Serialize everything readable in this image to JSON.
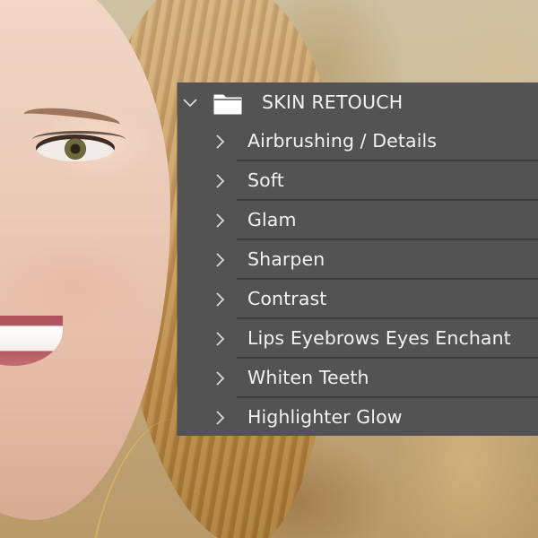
{
  "layers_panel": {
    "group": {
      "label": "SKIN RETOUCH",
      "icon": "folder-icon",
      "expanded_icon": "chevron-down-icon"
    },
    "items": [
      {
        "label": "Airbrushing / Details",
        "icon": "chevron-right-icon"
      },
      {
        "label": "Soft",
        "icon": "chevron-right-icon"
      },
      {
        "label": "Glam",
        "icon": "chevron-right-icon"
      },
      {
        "label": "Sharpen",
        "icon": "chevron-right-icon"
      },
      {
        "label": "Contrast",
        "icon": "chevron-right-icon"
      },
      {
        "label": "Lips Eyebrows Eyes Enchant",
        "icon": "chevron-right-icon"
      },
      {
        "label": "Whiten Teeth",
        "icon": "chevron-right-icon"
      },
      {
        "label": "Highlighter Glow",
        "icon": "chevron-right-icon"
      }
    ],
    "colors": {
      "panel_bg": "#535353",
      "text": "#f2f2f2",
      "divider": "#3d3d3d"
    }
  }
}
